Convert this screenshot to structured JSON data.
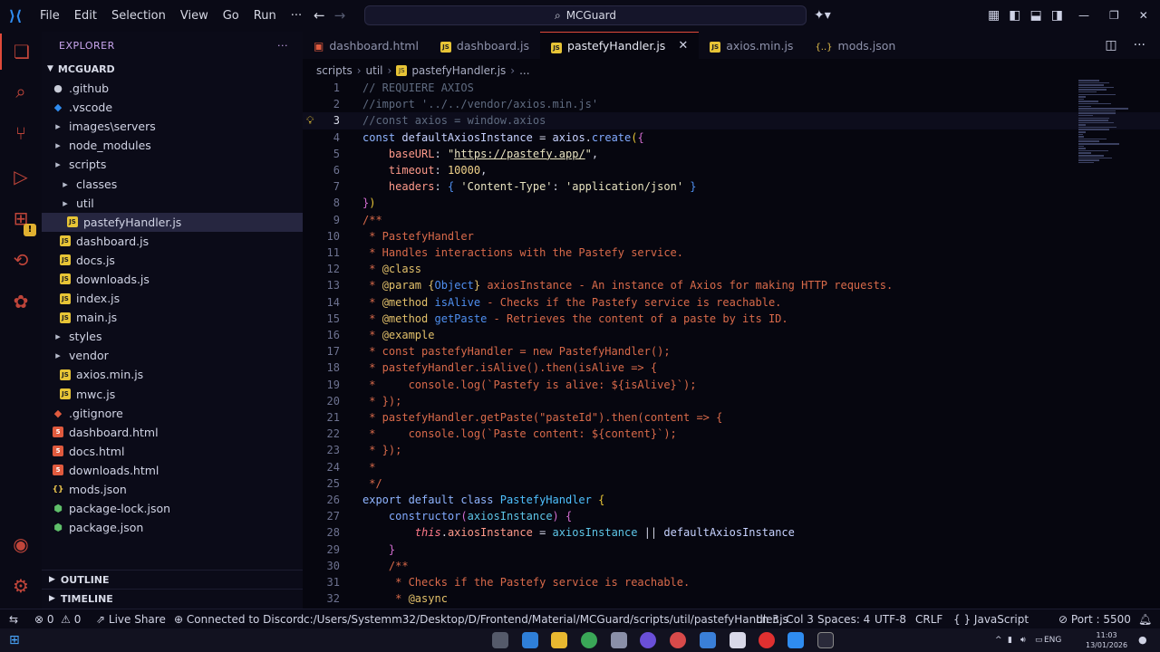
{
  "menu": [
    "File",
    "Edit",
    "Selection",
    "View",
    "Go",
    "Run",
    "···"
  ],
  "search": {
    "value": "MCGuard"
  },
  "explorer": {
    "title": "EXPLORER",
    "more": "···",
    "root": "MCGUARD",
    "items": [
      {
        "label": ".github",
        "icon": "github-folder-icon",
        "indent": 1
      },
      {
        "label": ".vscode",
        "icon": "vscode-folder-icon",
        "indent": 1
      },
      {
        "label": "images\\servers",
        "icon": "folder-icon",
        "indent": 1
      },
      {
        "label": "node_modules",
        "icon": "folder-icon",
        "indent": 1
      },
      {
        "label": "scripts",
        "icon": "folder-icon",
        "indent": 1
      },
      {
        "label": "classes",
        "icon": "folder-icon",
        "indent": 2
      },
      {
        "label": "util",
        "icon": "folder-icon",
        "indent": 2
      },
      {
        "label": "pastefyHandler.js",
        "icon": "js-file-icon",
        "indent": 3,
        "selected": true
      },
      {
        "label": "dashboard.js",
        "icon": "js-file-icon",
        "indent": 2
      },
      {
        "label": "docs.js",
        "icon": "js-file-icon",
        "indent": 2
      },
      {
        "label": "downloads.js",
        "icon": "js-file-icon",
        "indent": 2
      },
      {
        "label": "index.js",
        "icon": "js-file-icon",
        "indent": 2
      },
      {
        "label": "main.js",
        "icon": "js-file-icon",
        "indent": 2
      },
      {
        "label": "styles",
        "icon": "folder-icon",
        "indent": 1
      },
      {
        "label": "vendor",
        "icon": "folder-icon",
        "indent": 1
      },
      {
        "label": "axios.min.js",
        "icon": "js-file-icon",
        "indent": 2
      },
      {
        "label": "mwc.js",
        "icon": "js-file-icon",
        "indent": 2
      },
      {
        "label": ".gitignore",
        "icon": "git-file-icon",
        "indent": 1
      },
      {
        "label": "dashboard.html",
        "icon": "html-file-icon",
        "indent": 1
      },
      {
        "label": "docs.html",
        "icon": "html-file-icon",
        "indent": 1
      },
      {
        "label": "downloads.html",
        "icon": "html-file-icon",
        "indent": 1
      },
      {
        "label": "mods.json",
        "icon": "json-file-icon",
        "indent": 1
      },
      {
        "label": "package-lock.json",
        "icon": "npm-file-icon",
        "indent": 1
      },
      {
        "label": "package.json",
        "icon": "npm-file-icon",
        "indent": 1
      }
    ],
    "outline": "OUTLINE",
    "timeline": "TIMELINE"
  },
  "tabs": [
    {
      "label": "dashboard.html",
      "icon": "html"
    },
    {
      "label": "dashboard.js",
      "icon": "js"
    },
    {
      "label": "pastefyHandler.js",
      "icon": "js",
      "active": true
    },
    {
      "label": "axios.min.js",
      "icon": "js"
    },
    {
      "label": "mods.json",
      "icon": "json"
    }
  ],
  "breadcrumb": [
    "scripts",
    "util",
    "pastefyHandler.js",
    "..."
  ],
  "editor": {
    "current_line": 3,
    "lines": [
      [
        [
          "cm",
          "// REQUIERE AXIOS"
        ]
      ],
      [
        [
          "cm",
          "//import '../../vendor/axios.min.js'"
        ]
      ],
      [
        [
          "cm",
          "//const axios = window.axios"
        ]
      ],
      [
        [
          "kw",
          "const "
        ],
        [
          "vr",
          "defaultAxiosInstance"
        ],
        [
          "pl",
          " = "
        ],
        [
          "vr",
          "axios"
        ],
        [
          "pl",
          "."
        ],
        [
          "fn",
          "create"
        ],
        [
          "br1",
          "("
        ],
        [
          "br2",
          "{"
        ]
      ],
      [
        [
          "pl",
          "    "
        ],
        [
          "prop",
          "baseURL"
        ],
        [
          "pl",
          ": "
        ],
        [
          "str",
          "\""
        ],
        [
          "str url",
          "https://pastefy.app/"
        ],
        [
          "str",
          "\""
        ],
        [
          "pl",
          ","
        ]
      ],
      [
        [
          "pl",
          "    "
        ],
        [
          "prop",
          "timeout"
        ],
        [
          "pl",
          ": "
        ],
        [
          "num",
          "10000"
        ],
        [
          "pl",
          ","
        ]
      ],
      [
        [
          "pl",
          "    "
        ],
        [
          "prop",
          "headers"
        ],
        [
          "pl",
          ": "
        ],
        [
          "br3",
          "{ "
        ],
        [
          "str",
          "'Content-Type'"
        ],
        [
          "pl",
          ": "
        ],
        [
          "str",
          "'application/json'"
        ],
        [
          "br3",
          " }"
        ]
      ],
      [
        [
          "br2",
          "}"
        ],
        [
          "br1",
          ")"
        ]
      ],
      [
        [
          "doc",
          "/**"
        ]
      ],
      [
        [
          "doc",
          " * PastefyHandler"
        ]
      ],
      [
        [
          "doc",
          " * Handles interactions with the Pastefy service."
        ]
      ],
      [
        [
          "doc",
          " * "
        ],
        [
          "dtag",
          "@class"
        ]
      ],
      [
        [
          "doc",
          " * "
        ],
        [
          "dtag",
          "@param"
        ],
        [
          "doc",
          " "
        ],
        [
          "dtag",
          "{"
        ],
        [
          "dtype",
          "Object"
        ],
        [
          "dtag",
          "}"
        ],
        [
          "doc",
          " axiosInstance - An instance of Axios for making HTTP requests."
        ]
      ],
      [
        [
          "doc",
          " * "
        ],
        [
          "dtag",
          "@method"
        ],
        [
          "doc",
          " "
        ],
        [
          "dname",
          "isAlive"
        ],
        [
          "doc",
          " - Checks if the Pastefy service is reachable."
        ]
      ],
      [
        [
          "doc",
          " * "
        ],
        [
          "dtag",
          "@method"
        ],
        [
          "doc",
          " "
        ],
        [
          "dname",
          "getPaste"
        ],
        [
          "doc",
          " - Retrieves the content of a paste by its ID."
        ]
      ],
      [
        [
          "doc",
          " * "
        ],
        [
          "dtag",
          "@example"
        ]
      ],
      [
        [
          "doc",
          " * const pastefyHandler = new PastefyHandler();"
        ]
      ],
      [
        [
          "doc",
          " * pastefyHandler.isAlive().then(isAlive => {"
        ]
      ],
      [
        [
          "doc",
          " *     console.log(`Pastefy is alive: ${isAlive}`);"
        ]
      ],
      [
        [
          "doc",
          " * });"
        ]
      ],
      [
        [
          "doc",
          " * pastefyHandler.getPaste(\"pasteId\").then(content => {"
        ]
      ],
      [
        [
          "doc",
          " *     console.log(`Paste content: ${content}`);"
        ]
      ],
      [
        [
          "doc",
          " * });"
        ]
      ],
      [
        [
          "doc",
          " *"
        ]
      ],
      [
        [
          "doc",
          " */"
        ]
      ],
      [
        [
          "kw",
          "export default class "
        ],
        [
          "cls",
          "PastefyHandler"
        ],
        [
          "pl",
          " "
        ],
        [
          "br1",
          "{"
        ]
      ],
      [
        [
          "pl",
          "    "
        ],
        [
          "fn",
          "constructor"
        ],
        [
          "br2",
          "("
        ],
        [
          "param",
          "axiosInstance"
        ],
        [
          "br2",
          ")"
        ],
        [
          "pl",
          " "
        ],
        [
          "br2",
          "{"
        ]
      ],
      [
        [
          "pl",
          "        "
        ],
        [
          "this",
          "this"
        ],
        [
          "pl",
          "."
        ],
        [
          "prop",
          "axiosInstance"
        ],
        [
          "pl",
          " = "
        ],
        [
          "param",
          "axiosInstance"
        ],
        [
          "pl",
          " || "
        ],
        [
          "vr",
          "defaultAxiosInstance"
        ]
      ],
      [
        [
          "pl",
          "    "
        ],
        [
          "br2",
          "}"
        ]
      ],
      [
        [
          "doc",
          "    /**"
        ]
      ],
      [
        [
          "doc",
          "     * Checks if the Pastefy service is reachable."
        ]
      ],
      [
        [
          "doc",
          "     * "
        ],
        [
          "dtag",
          "@async"
        ]
      ]
    ]
  },
  "statusbar": {
    "remote": "⇆",
    "errors": "0",
    "warnings": "0",
    "liveshare": "Live Share",
    "discord": "Connected to Discord",
    "path": "c:/Users/Systemm32/Desktop/D/Frontend/Material/MCGuard/scripts/util/pastefyHandler.js",
    "position": "Ln 3, Col 3",
    "spaces": "Spaces: 4",
    "encoding": "UTF-8",
    "eol": "CRLF",
    "language": "JavaScript",
    "port": "Port : 5500"
  },
  "taskbar": {
    "lang": "ENG",
    "time": "11:03",
    "date": "13/01/2026"
  },
  "colors": {
    "accent": "#e04a3a",
    "background": "#06060f",
    "sidebar": "#0b0b18"
  }
}
